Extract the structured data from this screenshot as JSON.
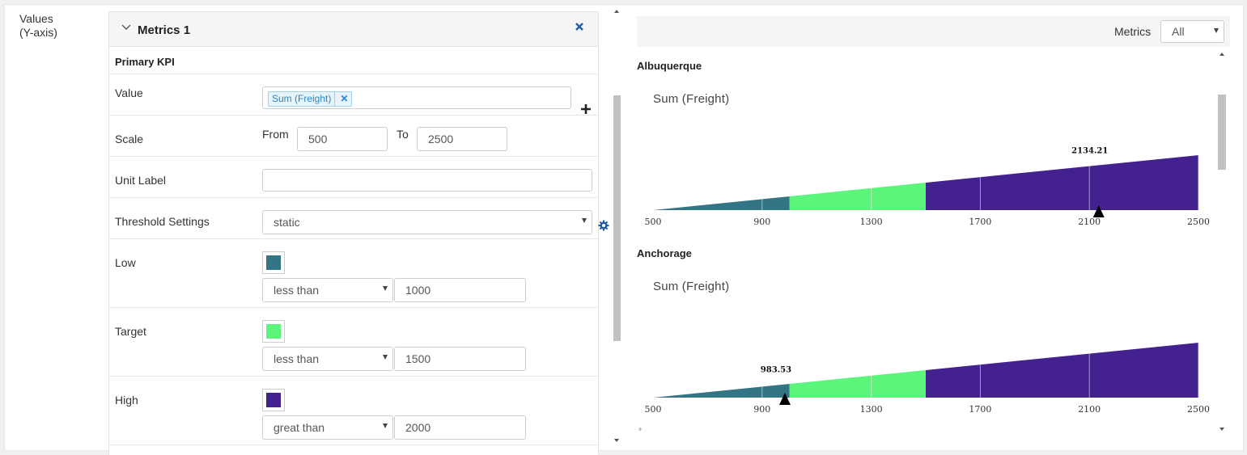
{
  "values_label": [
    "Values",
    "(Y-axis)"
  ],
  "metric": {
    "title": "Metrics 1",
    "primary_kpi": "Primary KPI",
    "value_label": "Value",
    "value_chip": "Sum (Freight)",
    "scale_label": "Scale",
    "scale_from_label": "From",
    "scale_from": "500",
    "scale_to_label": "To",
    "scale_to": "2500",
    "unit_label": "Unit Label",
    "unit_value": "",
    "threshold_label": "Threshold Settings",
    "threshold_value": "static",
    "low_label": "Low",
    "low_color": "#337485",
    "low_op": "less than",
    "low_value": "1000",
    "target_label": "Target",
    "target_color": "#5af57a",
    "target_op": "less than",
    "target_value": "1500",
    "high_label": "High",
    "high_color": "#43218f",
    "high_op": "great than",
    "high_value": "2000"
  },
  "filter": {
    "label": "Metrics",
    "value": "All"
  },
  "footer_mark": "°",
  "chart_data": [
    {
      "type": "bullet",
      "city": "Albuquerque",
      "title": "Sum (Freight)",
      "value": 2134.21,
      "value_label": "2134.21",
      "range": [
        500,
        2500
      ],
      "ticks": [
        500,
        900,
        1300,
        1700,
        2100,
        2500
      ],
      "bands": [
        {
          "name": "Low",
          "to": 1000,
          "color": "#337485"
        },
        {
          "name": "Target",
          "to": 1500,
          "color": "#5af57a"
        },
        {
          "name": "High",
          "to": 2500,
          "color": "#43218f"
        }
      ]
    },
    {
      "type": "bullet",
      "city": "Anchorage",
      "title": "Sum (Freight)",
      "value": 983.53,
      "value_label": "983.53",
      "range": [
        500,
        2500
      ],
      "ticks": [
        500,
        900,
        1300,
        1700,
        2100,
        2500
      ],
      "bands": [
        {
          "name": "Low",
          "to": 1000,
          "color": "#337485"
        },
        {
          "name": "Target",
          "to": 1500,
          "color": "#5af57a"
        },
        {
          "name": "High",
          "to": 2500,
          "color": "#43218f"
        }
      ]
    }
  ]
}
